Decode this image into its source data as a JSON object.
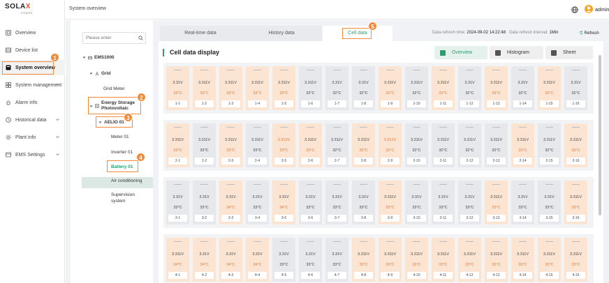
{
  "brand": {
    "logo_main": "SOLA",
    "logo_x": "X",
    "logo_sub": "POWER"
  },
  "colors": {
    "accent": "#2e9c6e",
    "highlight": "#f28a3a",
    "warm_cell": "#fbe4d2",
    "normal_cell": "#e6e8eb",
    "hot_text": "#e67a2e"
  },
  "sidebar": {
    "items": [
      {
        "label": "Overview",
        "icon": "overview-icon",
        "badge": ""
      },
      {
        "label": "Device list",
        "icon": "device-list-icon",
        "badge": ""
      },
      {
        "label": "System overview",
        "icon": "system-overview-icon",
        "badge": "1",
        "active": true
      },
      {
        "label": "System management",
        "icon": "system-management-icon",
        "badge": "",
        "chevron": true
      },
      {
        "label": "Alarm info",
        "icon": "alarm-icon",
        "badge": ""
      },
      {
        "label": "Historical data",
        "icon": "historical-data-icon",
        "badge": "",
        "chevron": true
      },
      {
        "label": "Plant info",
        "icon": "plant-info-icon",
        "badge": "",
        "chevron": true
      },
      {
        "label": "EMS Settings",
        "icon": "ems-settings-icon",
        "badge": "",
        "chevron": true
      }
    ]
  },
  "topbar": {
    "breadcrumb": "System overview",
    "user": "admin"
  },
  "tree": {
    "search_placeholder": "Please enter",
    "ems": "EMS1000",
    "grid": "Grid",
    "grid_meter": "Grid Meter",
    "energy_storage_l1": "Energy Storage",
    "energy_storage_l2": "Photovoltaic",
    "badge_storage": "2",
    "aelio": "AELIO 01",
    "badge_aelio": "3",
    "meter": "Meter 01",
    "inverter": "Inverter 01",
    "battery": "Battery 01",
    "badge_battery": "4",
    "air": "Air conditioning",
    "supervision_l1": "Supervision",
    "supervision_l2": "system"
  },
  "tabs": [
    {
      "label": "Real-time data"
    },
    {
      "label": "History data"
    },
    {
      "label": "Cell data",
      "badge": "5",
      "active": true
    }
  ],
  "refresh": {
    "time_label": "Data refresh time:",
    "time_value": "2024-09-02 14:22:48",
    "interval_label": "Data refresh interval:",
    "interval_value": "1Min",
    "refresh_button": "Refresh"
  },
  "panel": {
    "title": "Cell data display",
    "views": [
      {
        "label": "Overview",
        "active": true
      },
      {
        "label": "Histogram"
      },
      {
        "label": "Sheet"
      }
    ]
  },
  "groups": [
    {
      "cells": [
        {
          "id": "1-1",
          "v": "3.31V",
          "t": "33°C",
          "w": 1
        },
        {
          "id": "1-2",
          "v": "3.311V",
          "t": "33°C",
          "w": 1
        },
        {
          "id": "1-3",
          "v": "3.311V",
          "t": "33°C",
          "w": 1
        },
        {
          "id": "1-4",
          "v": "3.311V",
          "t": "33°C",
          "w": 1
        },
        {
          "id": "1-5",
          "v": "3.311V",
          "t": "33°C",
          "w": 1
        },
        {
          "id": "1-6",
          "v": "3.311V",
          "t": "32°C",
          "w": 0
        },
        {
          "id": "1-7",
          "v": "3.31V",
          "t": "32°C",
          "w": 0
        },
        {
          "id": "1-8",
          "v": "3.31V",
          "t": "32°C",
          "w": 0
        },
        {
          "id": "1-9",
          "v": "3.311V",
          "t": "32°C",
          "w": 1
        },
        {
          "id": "1-10",
          "v": "3.311V",
          "t": "32°C",
          "w": 0
        },
        {
          "id": "1-11",
          "v": "3.311V",
          "t": "33°C",
          "w": 1
        },
        {
          "id": "1-12",
          "v": "3.31V",
          "t": "32°C",
          "w": 0
        },
        {
          "id": "1-13",
          "v": "3.311V",
          "t": "33°C",
          "w": 1
        },
        {
          "id": "1-14",
          "v": "3.31V",
          "t": "32°C",
          "w": 0
        },
        {
          "id": "1-15",
          "v": "3.311V",
          "t": "32°C",
          "w": 1
        },
        {
          "id": "1-16",
          "v": "3.31V",
          "t": "32°C",
          "w": 0
        }
      ]
    },
    {
      "cells": [
        {
          "id": "2-1",
          "v": "3.311V",
          "t": "33°C",
          "w": 1
        },
        {
          "id": "2-2",
          "v": "3.311V",
          "t": "33°C",
          "w": 0
        },
        {
          "id": "2-3",
          "v": "3.311V",
          "t": "33°C",
          "w": 1
        },
        {
          "id": "2-4",
          "v": "3.311V",
          "t": "33°C",
          "w": 0
        },
        {
          "id": "2-5",
          "v": "3.312V",
          "t": "33°C",
          "w": 1
        },
        {
          "id": "2-6",
          "v": "3.311V",
          "t": "33°C",
          "w": 1
        },
        {
          "id": "2-7",
          "v": "3.311V",
          "t": "32°C",
          "w": 0
        },
        {
          "id": "2-8",
          "v": "3.311V",
          "t": "33°C",
          "w": 1
        },
        {
          "id": "2-9",
          "v": "3.312V",
          "t": "32°C",
          "w": 1
        },
        {
          "id": "2-10",
          "v": "3.311V",
          "t": "32°C",
          "w": 0
        },
        {
          "id": "2-11",
          "v": "3.311V",
          "t": "32°C",
          "w": 0
        },
        {
          "id": "2-12",
          "v": "3.311V",
          "t": "32°C",
          "w": 0
        },
        {
          "id": "2-13",
          "v": "3.311V",
          "t": "32°C",
          "w": 0
        },
        {
          "id": "2-14",
          "v": "3.311V",
          "t": "33°C",
          "w": 1
        },
        {
          "id": "2-15",
          "v": "3.311V",
          "t": "32°C",
          "w": 0
        },
        {
          "id": "2-16",
          "v": "3.311V",
          "t": "33°C",
          "w": 1
        }
      ]
    },
    {
      "cells": [
        {
          "id": "3-1",
          "v": "3.31V",
          "t": "33°C",
          "w": 0
        },
        {
          "id": "3-2",
          "v": "3.31V",
          "t": "33°C",
          "w": 0
        },
        {
          "id": "3-3",
          "v": "3.31V",
          "t": "34°C",
          "w": 1
        },
        {
          "id": "3-4",
          "v": "3.31V",
          "t": "33°C",
          "w": 0
        },
        {
          "id": "3-5",
          "v": "3.31V",
          "t": "34°C",
          "w": 1
        },
        {
          "id": "3-6",
          "v": "3.31V",
          "t": "33°C",
          "w": 0
        },
        {
          "id": "3-7",
          "v": "3.31V",
          "t": "33°C",
          "w": 0
        },
        {
          "id": "3-8",
          "v": "3.31V",
          "t": "33°C",
          "w": 0
        },
        {
          "id": "3-9",
          "v": "3.311V",
          "t": "33°C",
          "w": 1
        },
        {
          "id": "3-10",
          "v": "3.31V",
          "t": "33°C",
          "w": 0
        },
        {
          "id": "3-11",
          "v": "3.31V",
          "t": "33°C",
          "w": 0
        },
        {
          "id": "3-12",
          "v": "3.31V",
          "t": "33°C",
          "w": 0
        },
        {
          "id": "3-13",
          "v": "3.311V",
          "t": "33°C",
          "w": 1
        },
        {
          "id": "3-14",
          "v": "3.31V",
          "t": "33°C",
          "w": 0
        },
        {
          "id": "3-15",
          "v": "3.31V",
          "t": "33°C",
          "w": 0
        },
        {
          "id": "3-16",
          "v": "3.311V",
          "t": "33°C",
          "w": 1
        }
      ]
    },
    {
      "cells": [
        {
          "id": "4-1",
          "v": "3.311V",
          "t": "34°C",
          "w": 1
        },
        {
          "id": "4-2",
          "v": "3.31V",
          "t": "34°C",
          "w": 1
        },
        {
          "id": "4-3",
          "v": "3.31V",
          "t": "34°C",
          "w": 1
        },
        {
          "id": "4-4",
          "v": "3.31V",
          "t": "34°C",
          "w": 1
        },
        {
          "id": "4-5",
          "v": "3.31V",
          "t": "33°C",
          "w": 0
        },
        {
          "id": "4-6",
          "v": "3.31V",
          "t": "33°C",
          "w": 0
        },
        {
          "id": "4-7",
          "v": "3.31V",
          "t": "33°C",
          "w": 0
        },
        {
          "id": "4-8",
          "v": "3.311V",
          "t": "33°C",
          "w": 1
        },
        {
          "id": "4-9",
          "v": "3.311V",
          "t": "33°C",
          "w": 1
        },
        {
          "id": "4-10",
          "v": "3.311V",
          "t": "33°C",
          "w": 1
        },
        {
          "id": "4-11",
          "v": "3.311V",
          "t": "33°C",
          "w": 1
        },
        {
          "id": "4-12",
          "v": "3.311V",
          "t": "33°C",
          "w": 1
        },
        {
          "id": "4-13",
          "v": "3.311V",
          "t": "33°C",
          "w": 1
        },
        {
          "id": "4-14",
          "v": "3.311V",
          "t": "33°C",
          "w": 1
        },
        {
          "id": "4-15",
          "v": "3.311V",
          "t": "33°C",
          "w": 1
        },
        {
          "id": "4-16",
          "v": "3.311V",
          "t": "33°C",
          "w": 1
        }
      ]
    }
  ]
}
